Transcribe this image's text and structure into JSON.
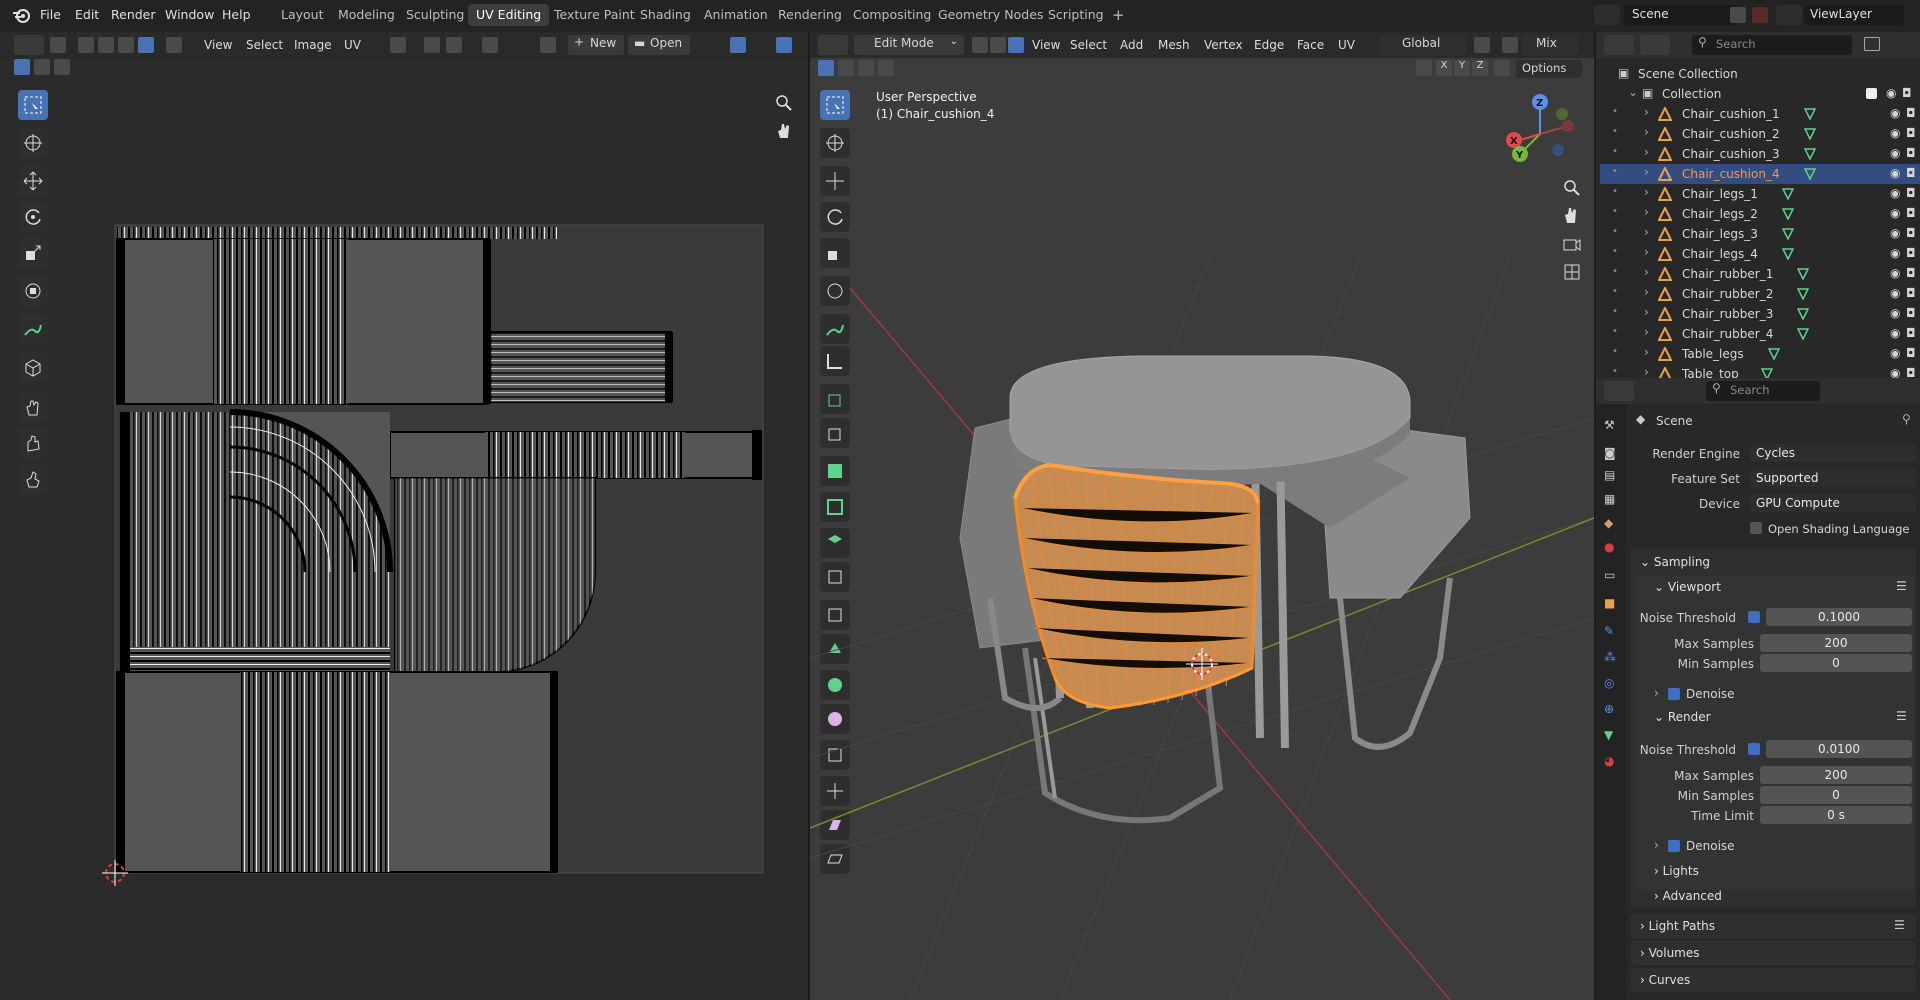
{
  "menubar": {
    "items": [
      "File",
      "Edit",
      "Render",
      "Window",
      "Help"
    ],
    "workspaces": [
      "Layout",
      "Modeling",
      "Sculpting",
      "UV Editing",
      "Texture Paint",
      "Shading",
      "Animation",
      "Rendering",
      "Compositing",
      "Geometry Nodes",
      "Scripting"
    ],
    "active_workspace": "UV Editing",
    "add_symbol": "+",
    "scene_name": "Scene",
    "viewlayer_name": "ViewLayer"
  },
  "uv_editor": {
    "menus": [
      "View",
      "Select",
      "Image",
      "UV"
    ],
    "new_label": "New",
    "open_label": "Open"
  },
  "viewport": {
    "mode": "Edit Mode",
    "menus": [
      "View",
      "Select",
      "Add",
      "Mesh",
      "Vertex",
      "Edge",
      "Face",
      "UV"
    ],
    "orientation": "Global",
    "shading_mix": "Mix",
    "options_label": "Options",
    "axes": [
      "X",
      "Y",
      "Z"
    ],
    "overlay_line1": "User Perspective",
    "overlay_line2": "(1) Chair_cushion_4",
    "gizmo": {
      "x": "X",
      "y": "Y",
      "z": "Z"
    }
  },
  "outliner": {
    "search_placeholder": "Search",
    "scene_collection": "Scene Collection",
    "collection": "Collection",
    "items": [
      "Chair_cushion_1",
      "Chair_cushion_2",
      "Chair_cushion_3",
      "Chair_cushion_4",
      "Chair_legs_1",
      "Chair_legs_2",
      "Chair_legs_3",
      "Chair_legs_4",
      "Chair_rubber_1",
      "Chair_rubber_2",
      "Chair_rubber_3",
      "Chair_rubber_4",
      "Table_legs",
      "Table_top"
    ],
    "selected": "Chair_cushion_4"
  },
  "properties": {
    "search_placeholder": "Search",
    "context": "Scene",
    "render_engine_label": "Render Engine",
    "render_engine": "Cycles",
    "feature_set_label": "Feature Set",
    "feature_set": "Supported",
    "device_label": "Device",
    "device": "GPU Compute",
    "osl_label": "Open Shading Language",
    "sampling": "Sampling",
    "viewport": {
      "title": "Viewport",
      "noise_threshold_label": "Noise Threshold",
      "noise_threshold": "0.1000",
      "max_samples_label": "Max Samples",
      "max_samples": "200",
      "min_samples_label": "Min Samples",
      "min_samples": "0",
      "denoise": "Denoise"
    },
    "render": {
      "title": "Render",
      "noise_threshold_label": "Noise Threshold",
      "noise_threshold": "0.0100",
      "max_samples_label": "Max Samples",
      "max_samples": "200",
      "min_samples_label": "Min Samples",
      "min_samples": "0",
      "time_limit_label": "Time Limit",
      "time_limit": "0 s",
      "denoise": "Denoise"
    },
    "lights": "Lights",
    "advanced": "Advanced",
    "light_paths": "Light Paths",
    "volumes": "Volumes",
    "curves": "Curves"
  },
  "colors": {
    "accent_blue": "#4772b3",
    "selection_orange": "#f29a4a",
    "mesh_icon_green": "#5fd28b",
    "object_icon_orange": "#e8a04a"
  }
}
